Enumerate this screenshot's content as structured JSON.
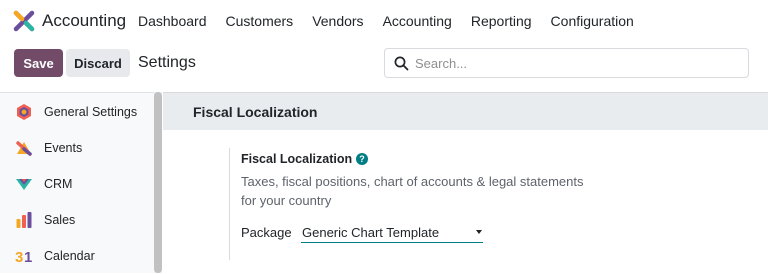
{
  "app": {
    "name": "Accounting",
    "logo_icon": "accounting-logo-icon"
  },
  "menu": [
    {
      "label": "Dashboard"
    },
    {
      "label": "Customers"
    },
    {
      "label": "Vendors"
    },
    {
      "label": "Accounting"
    },
    {
      "label": "Reporting"
    },
    {
      "label": "Configuration"
    }
  ],
  "controls": {
    "save_label": "Save",
    "discard_label": "Discard",
    "title": "Settings",
    "search_placeholder": "Search...",
    "search_value": ""
  },
  "sidebar": {
    "items": [
      {
        "label": "General Settings",
        "icon": "general-settings-icon"
      },
      {
        "label": "Events",
        "icon": "events-icon"
      },
      {
        "label": "CRM",
        "icon": "crm-icon"
      },
      {
        "label": "Sales",
        "icon": "sales-icon"
      },
      {
        "label": "Calendar",
        "icon": "calendar-icon"
      }
    ]
  },
  "section": {
    "heading": "Fiscal Localization",
    "setting": {
      "title": "Fiscal Localization",
      "help_symbol": "?",
      "description": "Taxes, fiscal positions, chart of accounts & legal statements for your country",
      "package_label": "Package",
      "package_value": "Generic Chart Template"
    }
  },
  "colors": {
    "brand": "#714b67",
    "accent": "#017e84",
    "section_bg": "#e9ecef"
  }
}
